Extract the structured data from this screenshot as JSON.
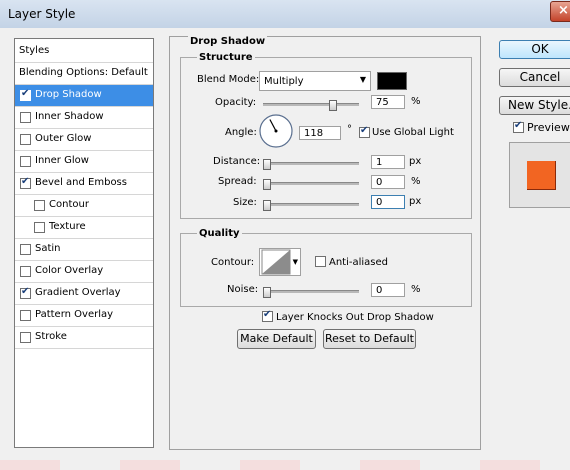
{
  "window": {
    "title": "Layer Style"
  },
  "styles_list": {
    "header": "Styles",
    "items": [
      {
        "label": "Blending Options: Default",
        "checkbox": false,
        "checked": false,
        "indent": 0,
        "selected": false
      },
      {
        "label": "Drop Shadow",
        "checkbox": true,
        "checked": true,
        "indent": 0,
        "selected": true
      },
      {
        "label": "Inner Shadow",
        "checkbox": true,
        "checked": false,
        "indent": 0,
        "selected": false
      },
      {
        "label": "Outer Glow",
        "checkbox": true,
        "checked": false,
        "indent": 0,
        "selected": false
      },
      {
        "label": "Inner Glow",
        "checkbox": true,
        "checked": false,
        "indent": 0,
        "selected": false
      },
      {
        "label": "Bevel and Emboss",
        "checkbox": true,
        "checked": true,
        "indent": 0,
        "selected": false
      },
      {
        "label": "Contour",
        "checkbox": true,
        "checked": false,
        "indent": 1,
        "selected": false
      },
      {
        "label": "Texture",
        "checkbox": true,
        "checked": false,
        "indent": 1,
        "selected": false
      },
      {
        "label": "Satin",
        "checkbox": true,
        "checked": false,
        "indent": 0,
        "selected": false
      },
      {
        "label": "Color Overlay",
        "checkbox": true,
        "checked": false,
        "indent": 0,
        "selected": false
      },
      {
        "label": "Gradient Overlay",
        "checkbox": true,
        "checked": true,
        "indent": 0,
        "selected": false
      },
      {
        "label": "Pattern Overlay",
        "checkbox": true,
        "checked": false,
        "indent": 0,
        "selected": false
      },
      {
        "label": "Stroke",
        "checkbox": true,
        "checked": false,
        "indent": 0,
        "selected": false
      }
    ]
  },
  "drop_shadow": {
    "heading": "Drop Shadow",
    "structure": {
      "heading": "Structure",
      "blend_mode_label": "Blend Mode:",
      "blend_mode_value": "Multiply",
      "shadow_color": "#000000",
      "opacity_label": "Opacity:",
      "opacity_value": "75",
      "opacity_unit": "%",
      "opacity_level": 0.75,
      "angle_label": "Angle:",
      "angle_value": "118",
      "angle_unit": "°",
      "use_global_light_label": "Use Global Light",
      "use_global_light_checked": true,
      "distance_label": "Distance:",
      "distance_value": "1",
      "distance_unit": "px",
      "spread_label": "Spread:",
      "spread_value": "0",
      "spread_unit": "%",
      "size_label": "Size:",
      "size_value": "0",
      "size_unit": "px"
    },
    "quality": {
      "heading": "Quality",
      "contour_label": "Contour:",
      "anti_aliased_label": "Anti-aliased",
      "anti_aliased_checked": false,
      "noise_label": "Noise:",
      "noise_value": "0",
      "noise_unit": "%"
    },
    "layer_knocks_out_label": "Layer Knocks Out Drop Shadow",
    "layer_knocks_out_checked": true,
    "make_default_label": "Make Default",
    "reset_default_label": "Reset to Default"
  },
  "actions": {
    "ok_label": "OK",
    "cancel_label": "Cancel",
    "new_style_label": "New Style...",
    "preview_label": "Preview",
    "preview_checked": true,
    "preview_color": "#f26522"
  }
}
